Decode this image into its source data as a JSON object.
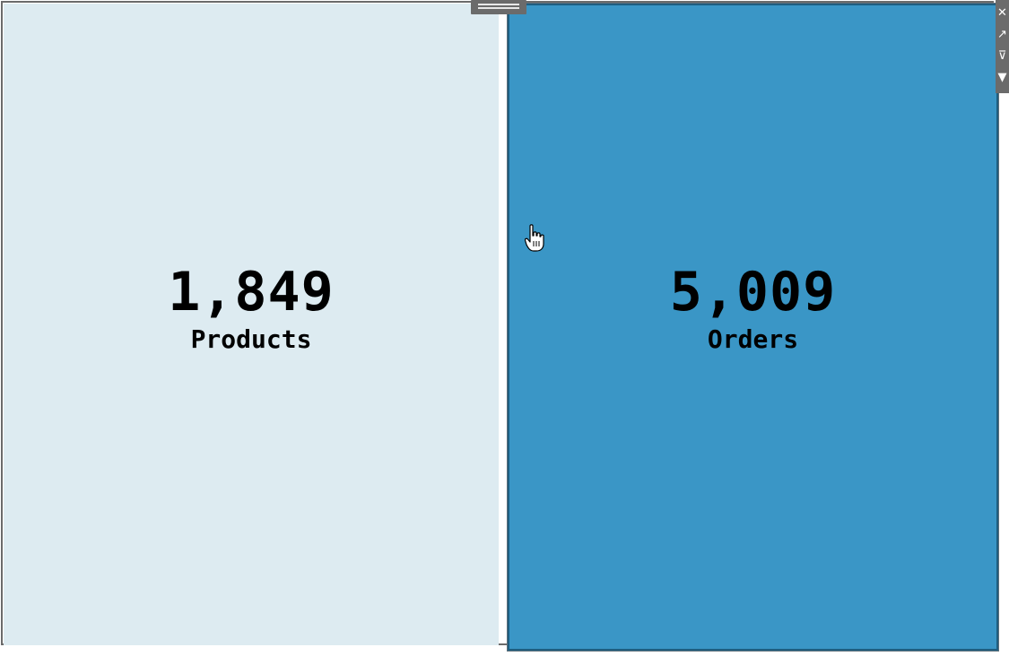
{
  "tiles": {
    "products": {
      "value": "1,849",
      "label": "Products",
      "background": "#ddebf1"
    },
    "orders": {
      "value": "5,009",
      "label": "Orders",
      "background": "#3a96c6"
    }
  },
  "toolbar": {
    "buttons": [
      {
        "icon": "close-icon",
        "glyph": "✕"
      },
      {
        "icon": "external-link-icon",
        "glyph": "↗"
      },
      {
        "icon": "filter-icon",
        "glyph": "⊽"
      },
      {
        "icon": "dropdown-arrow-icon",
        "glyph": "▼"
      }
    ]
  },
  "colors": {
    "frame": "#6b6b6b",
    "text": "#000000"
  }
}
